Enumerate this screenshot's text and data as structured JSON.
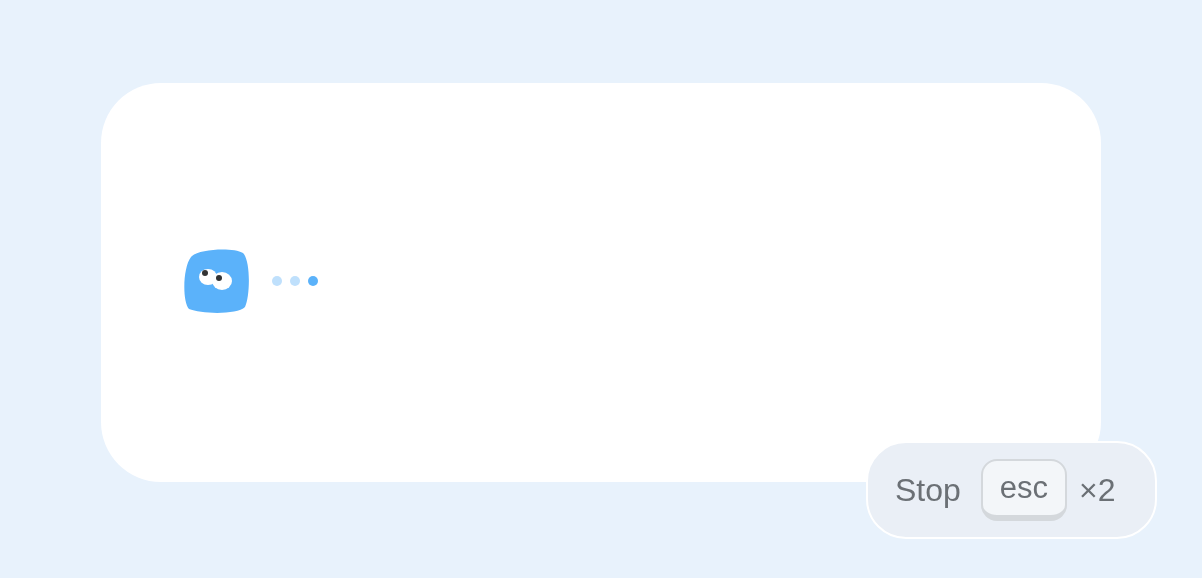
{
  "message": {
    "typing_dots": [
      {
        "active": false
      },
      {
        "active": false
      },
      {
        "active": true
      }
    ]
  },
  "stop_hint": {
    "label": "Stop",
    "key": "esc",
    "count": "×2"
  }
}
